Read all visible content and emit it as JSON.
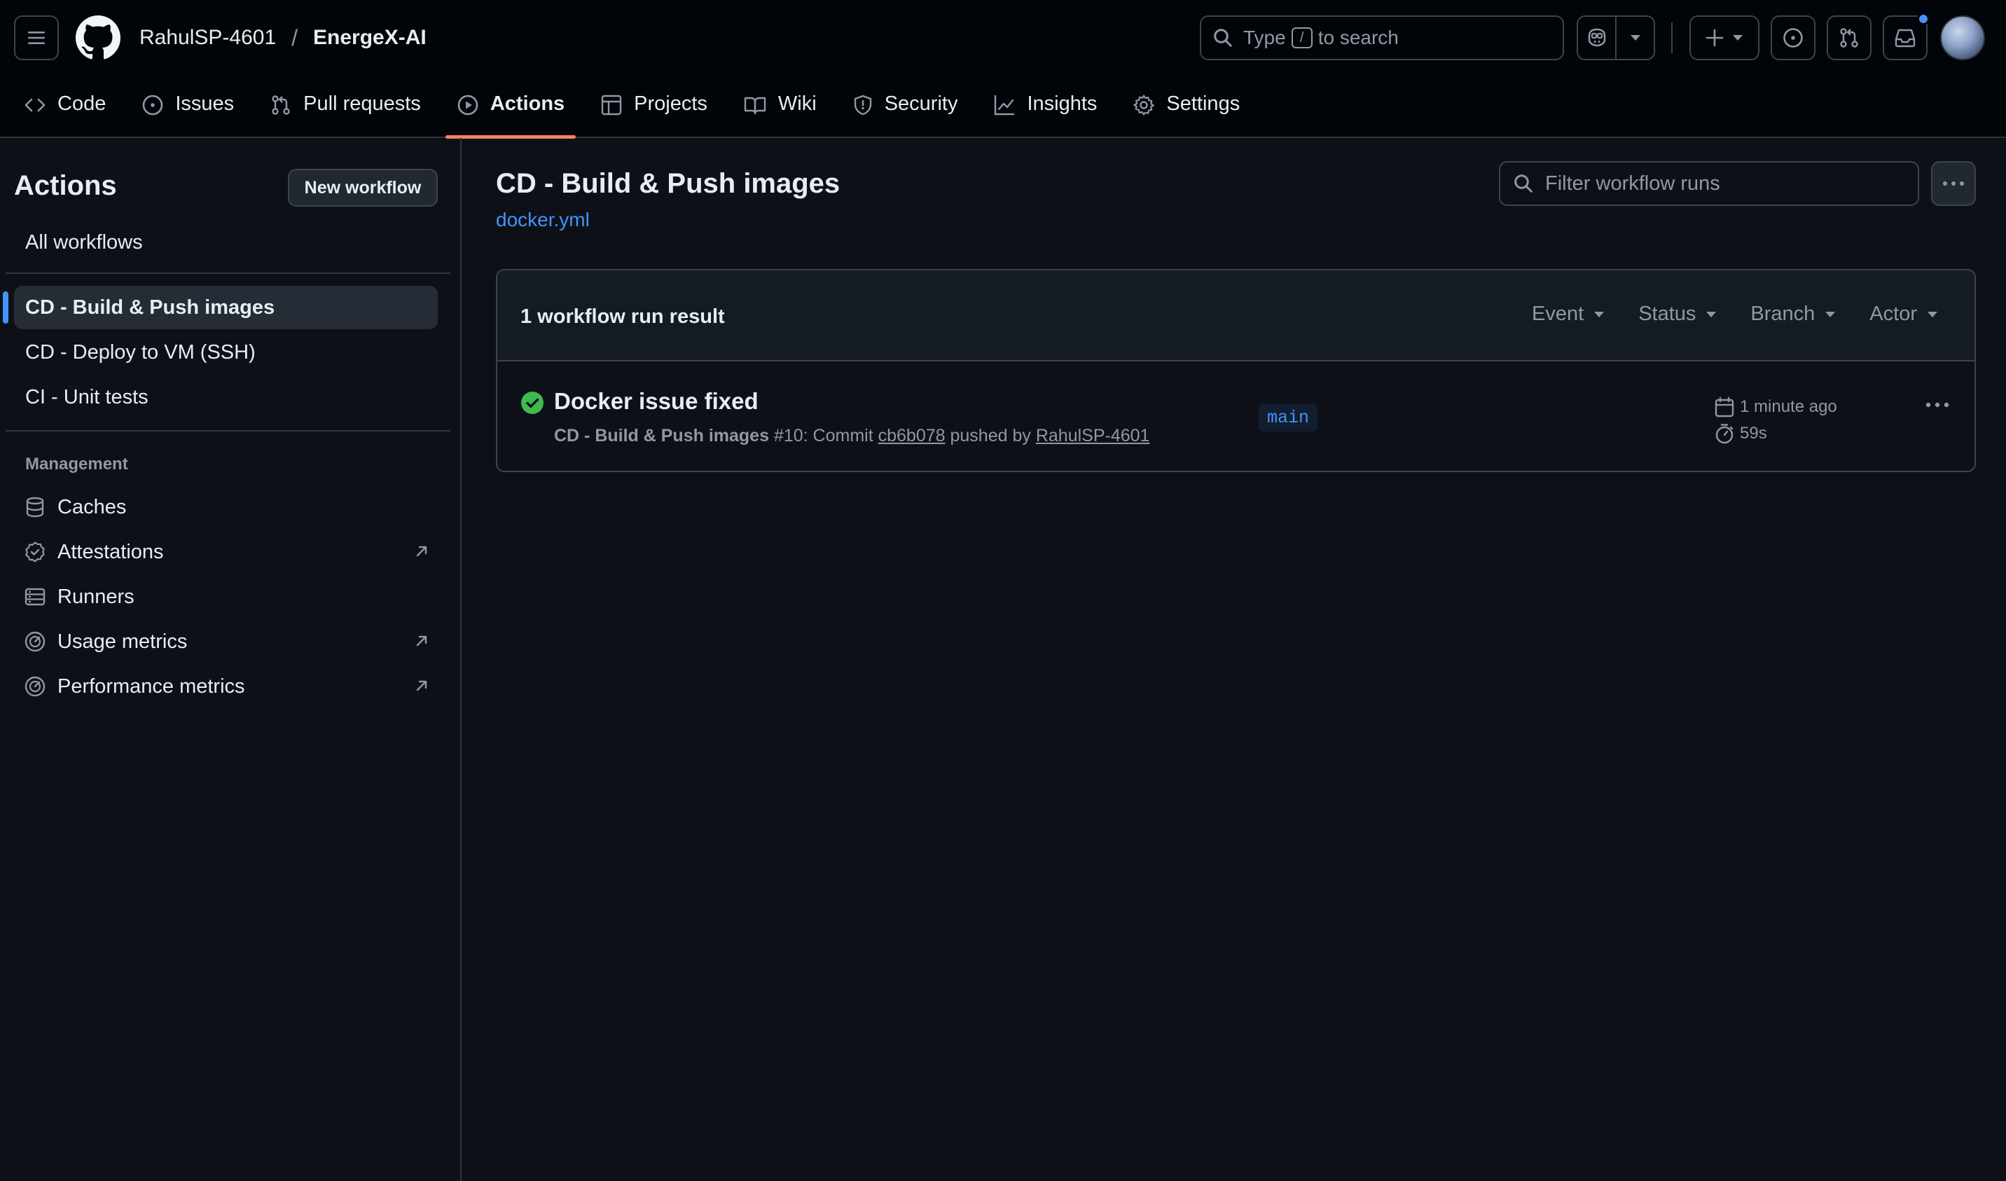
{
  "header": {
    "owner": "RahulSP-4601",
    "separator": "/",
    "repo": "EnergeX-AI",
    "search": {
      "prefix": "Type",
      "key": "/",
      "suffix": "to search"
    }
  },
  "tabs": [
    {
      "label": "Code",
      "icon": "code-icon"
    },
    {
      "label": "Issues",
      "icon": "issue-icon"
    },
    {
      "label": "Pull requests",
      "icon": "pull-request-icon"
    },
    {
      "label": "Actions",
      "icon": "play-icon",
      "active": true
    },
    {
      "label": "Projects",
      "icon": "table-icon"
    },
    {
      "label": "Wiki",
      "icon": "book-icon"
    },
    {
      "label": "Security",
      "icon": "shield-icon"
    },
    {
      "label": "Insights",
      "icon": "graph-icon"
    },
    {
      "label": "Settings",
      "icon": "gear-icon"
    }
  ],
  "sidebar": {
    "title": "Actions",
    "new_workflow": "New workflow",
    "all_workflows": "All workflows",
    "workflows": [
      {
        "label": "CD - Build & Push images",
        "selected": true
      },
      {
        "label": "CD - Deploy to VM (SSH)"
      },
      {
        "label": "CI - Unit tests"
      }
    ],
    "management_heading": "Management",
    "management": [
      {
        "label": "Caches",
        "icon": "database-icon"
      },
      {
        "label": "Attestations",
        "icon": "verified-icon",
        "external": true
      },
      {
        "label": "Runners",
        "icon": "server-icon"
      },
      {
        "label": "Usage metrics",
        "icon": "meter-icon",
        "external": true
      },
      {
        "label": "Performance metrics",
        "icon": "meter-icon",
        "external": true
      }
    ]
  },
  "main": {
    "title": "CD - Build & Push images",
    "file": "docker.yml",
    "filter_placeholder": "Filter workflow runs",
    "result_count": "1 workflow run result",
    "filters": [
      "Event",
      "Status",
      "Branch",
      "Actor"
    ],
    "runs": [
      {
        "title": "Docker issue fixed",
        "workflow": "CD - Build & Push images",
        "run_number": "#10",
        "commit_label": ": Commit",
        "commit": "cb6b078",
        "pushed_by_label": "pushed by",
        "actor": "RahulSP-4601",
        "branch": "main",
        "time_ago": "1 minute ago",
        "duration": "59s",
        "status": "success"
      }
    ]
  },
  "colors": {
    "bg": "#0d1117",
    "header_bg": "#010409",
    "accent_link": "#4493f8",
    "active_tab_underline": "#f78166",
    "success": "#3fb950",
    "muted_text": "#9198a1"
  }
}
